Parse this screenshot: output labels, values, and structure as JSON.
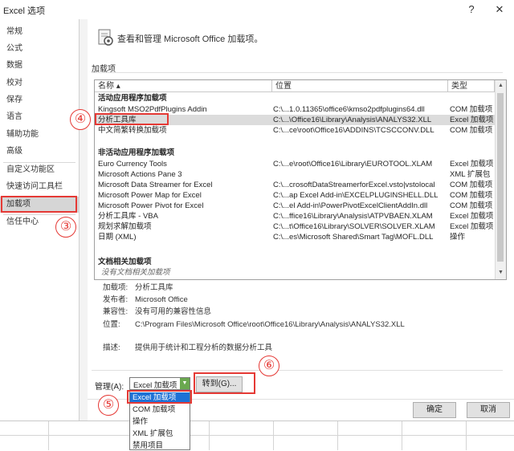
{
  "window": {
    "title": "Excel 选项",
    "help": "?",
    "close": "✕"
  },
  "sidebar": {
    "items": [
      "常规",
      "公式",
      "数据",
      "校对",
      "保存",
      "语言",
      "辅助功能",
      "高级",
      "自定义功能区",
      "快速访问工具栏",
      "加载项",
      "信任中心"
    ],
    "selected": "加载项"
  },
  "header": {
    "title": "查看和管理 Microsoft Office 加载项。"
  },
  "section_label": "加载项",
  "table": {
    "columns": [
      "名称 ▴",
      "位置",
      "类型"
    ],
    "groups": [
      {
        "label": "活动应用程序加载项",
        "rows": [
          [
            "Kingsoft MSO2PdfPlugins Addin",
            "C:\\...1.0.11365\\office6\\kmso2pdfplugins64.dll",
            "COM 加载项"
          ],
          [
            "分析工具库",
            "C:\\...\\Office16\\Library\\Analysis\\ANALYS32.XLL",
            "Excel 加载项"
          ],
          [
            "中文简繁转换加载项",
            "C:\\...ce\\root\\Office16\\ADDINS\\TCSCCONV.DLL",
            "COM 加载项"
          ]
        ]
      },
      {
        "label": "非活动应用程序加载项",
        "rows": [
          [
            "Euro Currency Tools",
            "C:\\...e\\root\\Office16\\Library\\EUROTOOL.XLAM",
            "Excel 加载项"
          ],
          [
            "Microsoft Actions Pane 3",
            "",
            "XML 扩展包"
          ],
          [
            "Microsoft Data Streamer for Excel",
            "C:\\...crosoftDataStreamerforExcel.vsto|vstolocal",
            "COM 加载项"
          ],
          [
            "Microsoft Power Map for Excel",
            "C:\\...ap Excel Add-in\\EXCELPLUGINSHELL.DLL",
            "COM 加载项"
          ],
          [
            "Microsoft Power Pivot for Excel",
            "C:\\...el Add-in\\PowerPivotExcelClientAddIn.dll",
            "COM 加载项"
          ],
          [
            "分析工具库 - VBA",
            "C:\\...ffice16\\Library\\Analysis\\ATPVBAEN.XLAM",
            "Excel 加载项"
          ],
          [
            "规划求解加载项",
            "C:\\...t\\Office16\\Library\\SOLVER\\SOLVER.XLAM",
            "Excel 加载项"
          ],
          [
            "日期 (XML)",
            "C:\\...es\\Microsoft Shared\\Smart Tag\\MOFL.DLL",
            "操作"
          ]
        ]
      },
      {
        "label": "文档相关加载项",
        "empty": "没有文档相关加载项"
      }
    ]
  },
  "details": {
    "addin_label": "加载项:",
    "addin_value": "分析工具库",
    "publisher_label": "发布者:",
    "publisher_value": "Microsoft Office",
    "compat_label": "兼容性:",
    "compat_value": "没有可用的兼容性信息",
    "location_label": "位置:",
    "location_value": "C:\\Program Files\\Microsoft Office\\root\\Office16\\Library\\Analysis\\ANALYS32.XLL",
    "desc_label": "描述:",
    "desc_value": "提供用于统计和工程分析的数据分析工具"
  },
  "manage": {
    "label": "管理(A):",
    "selected": "Excel 加载项",
    "goto": "转到(G)...",
    "options": [
      "Excel 加载项",
      "COM 加载项",
      "操作",
      "XML 扩展包",
      "禁用项目"
    ]
  },
  "footer": {
    "ok": "确定",
    "cancel": "取消"
  },
  "annotations": [
    "③",
    "④",
    "⑤",
    "⑥"
  ],
  "colors": {
    "highlight": "#e53935",
    "selection": "#1e72d6"
  }
}
